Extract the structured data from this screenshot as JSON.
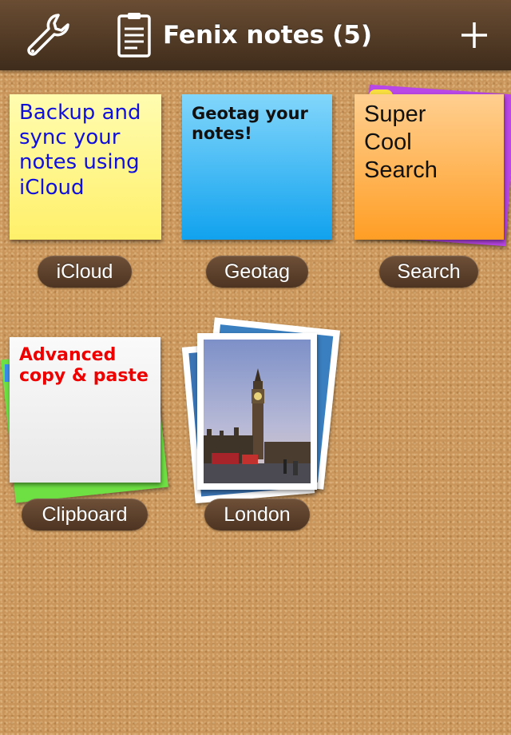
{
  "topbar": {
    "title": "Fenix notes",
    "count": "(5)",
    "settings_icon": "wrench-icon",
    "notes_list_icon": "clipboard-icon",
    "add_icon": "plus-icon"
  },
  "notes": [
    {
      "label": "iCloud",
      "lines": [
        "Backup and",
        "sync your",
        "notes using",
        "iCloud"
      ],
      "color": "#fff79a",
      "text_color": "#1010dd"
    },
    {
      "label": "Geotag",
      "lines": [
        "Geotag your",
        "notes!"
      ],
      "color": "#3aaef0",
      "text_color": "#111111"
    },
    {
      "label": "Search",
      "lines": [
        "Super",
        "Cool",
        "Search"
      ],
      "color": "#ffad4a",
      "text_color": "#111111"
    },
    {
      "label": "Clipboard",
      "lines": [
        "Advanced",
        "copy & paste"
      ],
      "color": "#f4f4f4",
      "text_color": "#ee0000"
    },
    {
      "label": "London"
    }
  ]
}
